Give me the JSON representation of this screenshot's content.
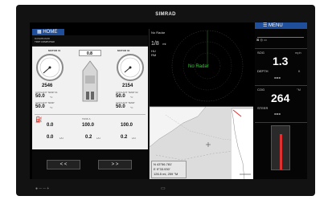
{
  "brand": "SIMRAD",
  "left_pane": {
    "home_label": "HOME",
    "subtitle_line1": "DASHBOARD",
    "subtitle_line2": "TRIP COMPUTER",
    "port_motor": {
      "label": "MOTOR 01",
      "gauge_value": "2546",
      "field1_label": "COOLANT TEMP 01",
      "field1_value": "50.0",
      "field1_unit": "°C",
      "field2_label": "COOLANT TEMP",
      "field2_value": "50.0",
      "field2_unit": "°C"
    },
    "stbd_motor": {
      "label": "MOTOR 02",
      "gauge_value": "2154",
      "field1_label": "COOLANT TEMP 02",
      "field1_value": "50.0",
      "field1_unit": "°C",
      "field2_label": "COOLANT TEMP",
      "field2_value": "50.0",
      "field2_unit": "°C"
    },
    "trim_value": "0.8",
    "fuel": {
      "section_label": "TANK A",
      "value1": "0.0",
      "value2": "100.0",
      "value3": "100.0",
      "value4": "0.0",
      "value5": "0.2",
      "value6": "0.2",
      "unit": "L/H"
    },
    "prev_label": "< <",
    "next_label": "> >"
  },
  "radar": {
    "label": "No Radar",
    "range": "1/8",
    "range_unit": "mi",
    "mode1": "HU",
    "mode2": "RM",
    "status": "No Radar"
  },
  "chart": {
    "lat": "N  43°56.781'",
    "lon": "E    9°33.930'",
    "dist": "126.5 mi, 259 °M"
  },
  "databar": {
    "menu_label": "MENU",
    "sog_label": "SOG",
    "sog_unit": "mph",
    "sog_value": "1.3",
    "depth_label": "DEPTH",
    "depth_unit": "ft",
    "depth_value": "---",
    "cog_label": "COG",
    "cog_unit": "°M",
    "cog_value": "264",
    "steer_label": "STEER",
    "steer_value": "---"
  },
  "colors": {
    "accent_blue": "#1f4e9b",
    "radar_green": "#33cc33",
    "route_red": "#e03030"
  }
}
